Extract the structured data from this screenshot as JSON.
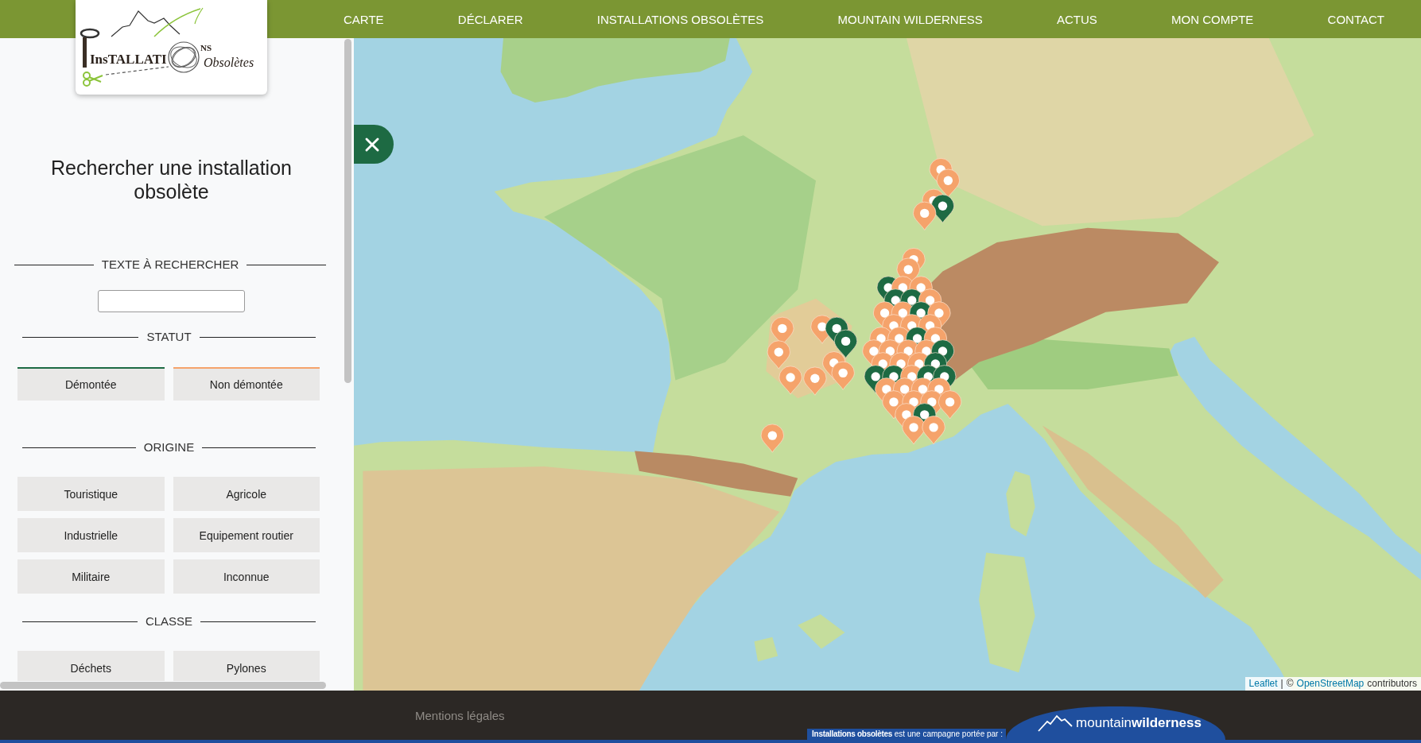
{
  "logo": {
    "title_start": "InsTALLATI",
    "title_end": "NS",
    "subtitle": "Obsolètes"
  },
  "nav": [
    {
      "label": "CARTE"
    },
    {
      "label": "DÉCLARER"
    },
    {
      "label": "INSTALLATIONS OBSOLÈTES"
    },
    {
      "label": "MOUNTAIN WILDERNESS"
    },
    {
      "label": "ACTUS"
    },
    {
      "label": "MON COMPTE"
    },
    {
      "label": "CONTACT"
    }
  ],
  "sidebar": {
    "title": "Rechercher une installation obsolète",
    "sections": [
      {
        "kind": "text",
        "heading": "TEXTE À RECHERCHER"
      },
      {
        "kind": "status",
        "heading": "STATUT",
        "options": [
          {
            "label": "Démontée",
            "color": "#1d6a43"
          },
          {
            "label": "Non démontée",
            "color": "#f5a36b"
          }
        ]
      },
      {
        "kind": "options",
        "heading": "ORIGINE",
        "options": [
          {
            "label": "Touristique"
          },
          {
            "label": "Agricole"
          },
          {
            "label": "Industrielle"
          },
          {
            "label": "Equipement routier"
          },
          {
            "label": "Militaire"
          },
          {
            "label": "Inconnue"
          }
        ]
      },
      {
        "kind": "options",
        "heading": "CLASSE",
        "options": [
          {
            "label": "Déchets"
          },
          {
            "label": "Pylones"
          }
        ]
      }
    ]
  },
  "map": {
    "markers": [
      {
        "kind": "standing"
      },
      {
        "kind": "standing"
      },
      {
        "kind": "standing"
      },
      {
        "kind": "dismantled"
      },
      {
        "kind": "standing"
      },
      {
        "kind": "standing"
      },
      {
        "kind": "standing"
      },
      {
        "kind": "dismantled"
      },
      {
        "kind": "standing"
      },
      {
        "kind": "standing"
      },
      {
        "kind": "dismantled"
      },
      {
        "kind": "dismantled"
      },
      {
        "kind": "standing"
      },
      {
        "kind": "standing"
      },
      {
        "kind": "standing"
      },
      {
        "kind": "dismantled"
      },
      {
        "kind": "standing"
      },
      {
        "kind": "standing"
      },
      {
        "kind": "standing"
      },
      {
        "kind": "standing"
      },
      {
        "kind": "standing"
      },
      {
        "kind": "standing"
      },
      {
        "kind": "dismantled"
      },
      {
        "kind": "standing"
      },
      {
        "kind": "standing"
      },
      {
        "kind": "dismantled"
      },
      {
        "kind": "standing"
      },
      {
        "kind": "dismantled"
      },
      {
        "kind": "standing"
      },
      {
        "kind": "standing"
      },
      {
        "kind": "standing"
      },
      {
        "kind": "standing"
      },
      {
        "kind": "dismantled"
      },
      {
        "kind": "standing"
      },
      {
        "kind": "standing"
      },
      {
        "kind": "standing"
      },
      {
        "kind": "standing"
      },
      {
        "kind": "standing"
      },
      {
        "kind": "dismantled"
      },
      {
        "kind": "standing"
      },
      {
        "kind": "dismantled"
      },
      {
        "kind": "dismantled"
      },
      {
        "kind": "standing"
      },
      {
        "kind": "dismantled"
      },
      {
        "kind": "dismantled"
      },
      {
        "kind": "standing"
      },
      {
        "kind": "standing"
      },
      {
        "kind": "standing"
      },
      {
        "kind": "standing"
      },
      {
        "kind": "standing"
      },
      {
        "kind": "standing"
      },
      {
        "kind": "standing"
      },
      {
        "kind": "standing"
      },
      {
        "kind": "standing"
      },
      {
        "kind": "standing"
      },
      {
        "kind": "standing"
      },
      {
        "kind": "dismantled"
      },
      {
        "kind": "standing"
      },
      {
        "kind": "standing"
      },
      {
        "kind": "standing"
      }
    ],
    "attribution": {
      "leaflet": "Leaflet",
      "separator": "|",
      "copyright": "©",
      "osm": "OpenStreetMap",
      "suffix": "contributors"
    }
  },
  "footer": {
    "legal": "Mentions légales",
    "campaign": "**Installations obsolètes** est une campagne portée par :",
    "partner": "mountain**wilderness**"
  }
}
